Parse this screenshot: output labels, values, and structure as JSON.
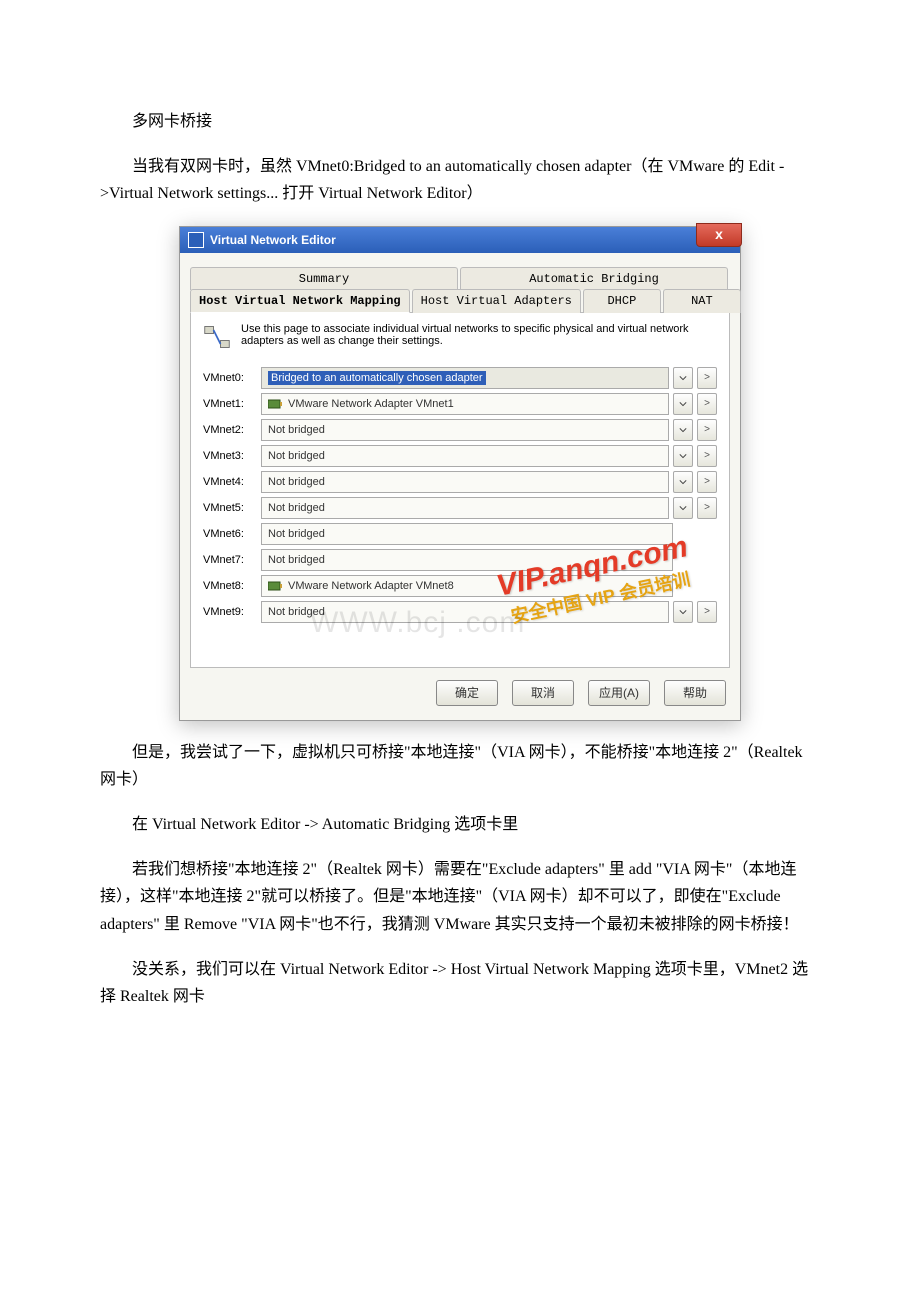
{
  "text": {
    "heading": "多网卡桥接",
    "p1": "当我有双网卡时，虽然 VMnet0:Bridged to an automatically chosen adapter（在 VMware 的 Edit ->Virtual Network settings... 打开 Virtual Network Editor）",
    "p2": "但是，我尝试了一下，虚拟机只可桥接\"本地连接\"（VIA 网卡），不能桥接\"本地连接 2\"（Realtek 网卡）",
    "p3": "在 Virtual Network Editor -> Automatic Bridging 选项卡里",
    "p4": "若我们想桥接\"本地连接 2\"（Realtek 网卡）需要在\"Exclude adapters\" 里 add \"VIA 网卡\"（本地连接），这样\"本地连接 2\"就可以桥接了。但是\"本地连接\"（VIA 网卡）却不可以了，即使在\"Exclude adapters\" 里 Remove \"VIA 网卡\"也不行，我猜测 VMware 其实只支持一个最初未被排除的网卡桥接！",
    "p5": "没关系，我们可以在 Virtual Network Editor -> Host Virtual Network Mapping 选项卡里，VMnet2 选择 Realtek 网卡"
  },
  "dialog": {
    "title": "Virtual Network Editor",
    "tabs_top": [
      "Summary",
      "Automatic Bridging"
    ],
    "tabs_bottom": [
      "Host Virtual Network Mapping",
      "Host Virtual Adapters",
      "DHCP",
      "NAT"
    ],
    "description": "Use this page to associate individual virtual networks to specific physical and virtual network adapters as well as change their settings.",
    "rows": [
      {
        "label": "VMnet0:",
        "value": "Bridged to an automatically chosen adapter",
        "selected": true,
        "hasDD": true,
        "hasMore": true,
        "icon": false
      },
      {
        "label": "VMnet1:",
        "value": "VMware Network Adapter VMnet1",
        "selected": false,
        "hasDD": true,
        "hasMore": true,
        "icon": true
      },
      {
        "label": "VMnet2:",
        "value": "Not bridged",
        "selected": false,
        "hasDD": true,
        "hasMore": true,
        "icon": false
      },
      {
        "label": "VMnet3:",
        "value": "Not bridged",
        "selected": false,
        "hasDD": true,
        "hasMore": true,
        "icon": false
      },
      {
        "label": "VMnet4:",
        "value": "Not bridged",
        "selected": false,
        "hasDD": true,
        "hasMore": true,
        "icon": false
      },
      {
        "label": "VMnet5:",
        "value": "Not bridged",
        "selected": false,
        "hasDD": true,
        "hasMore": true,
        "icon": false
      },
      {
        "label": "VMnet6:",
        "value": "Not bridged",
        "selected": false,
        "hasDD": false,
        "hasMore": false,
        "icon": false
      },
      {
        "label": "VMnet7:",
        "value": "Not bridged",
        "selected": false,
        "hasDD": false,
        "hasMore": false,
        "icon": false
      },
      {
        "label": "VMnet8:",
        "value": "VMware Network Adapter VMnet8",
        "selected": false,
        "hasDD": false,
        "hasMore": false,
        "icon": true
      },
      {
        "label": "VMnet9:",
        "value": "Not bridged",
        "selected": false,
        "hasDD": true,
        "hasMore": true,
        "icon": false
      }
    ],
    "buttons": {
      "ok": "确定",
      "cancel": "取消",
      "apply": "应用(A)",
      "help": "帮助"
    },
    "close": "x"
  },
  "watermarks": {
    "url": "VIP.anqn.com",
    "slogan": "安全中国 VIP 会员培训",
    "faint": "WWW.bcj     .com"
  }
}
